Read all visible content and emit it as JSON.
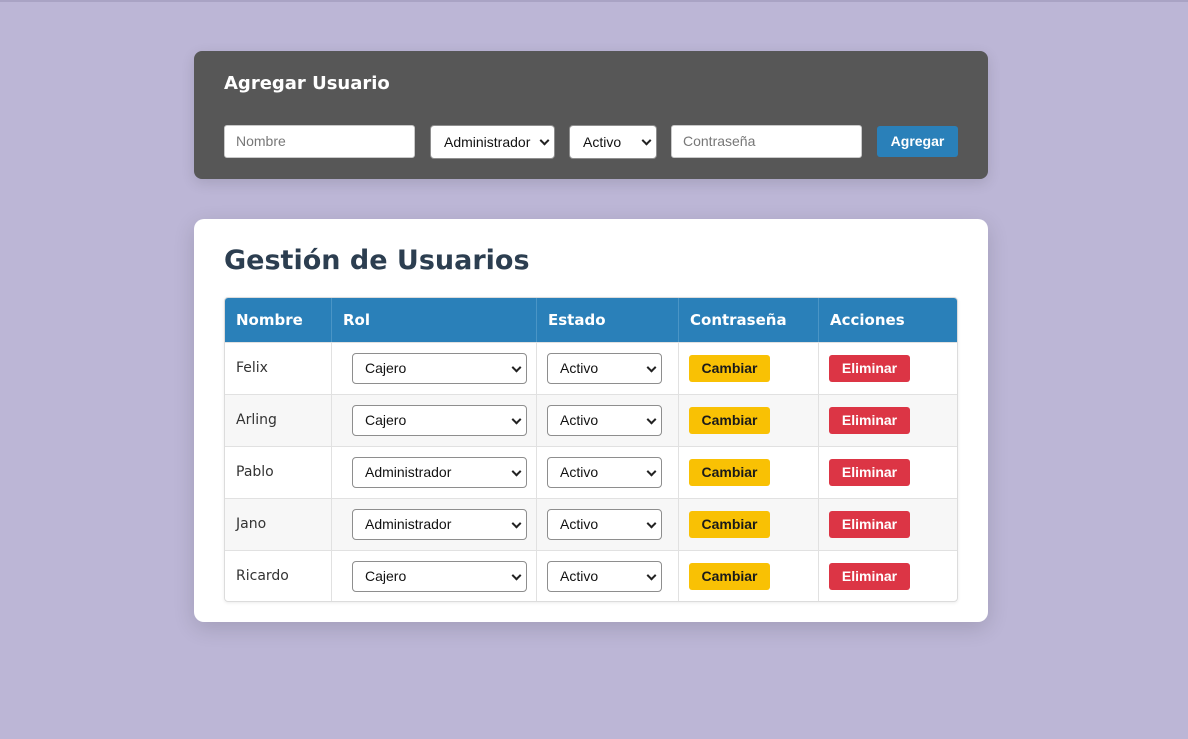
{
  "add_form": {
    "title": "Agregar Usuario",
    "name_placeholder": "Nombre",
    "role_selected": "Administrador",
    "status_selected": "Activo",
    "password_placeholder": "Contraseña",
    "submit_label": "Agregar"
  },
  "users_card": {
    "title": "Gestión de Usuarios",
    "columns": [
      "Nombre",
      "Rol",
      "Estado",
      "Contraseña",
      "Acciones"
    ],
    "change_label": "Cambiar",
    "delete_label": "Eliminar",
    "rows": [
      {
        "name": "Felix",
        "role": "Cajero",
        "status": "Activo"
      },
      {
        "name": "Arling",
        "role": "Cajero",
        "status": "Activo"
      },
      {
        "name": "Pablo",
        "role": "Administrador",
        "status": "Activo"
      },
      {
        "name": "Jano",
        "role": "Administrador",
        "status": "Activo"
      },
      {
        "name": "Ricardo",
        "role": "Cajero",
        "status": "Activo"
      }
    ]
  },
  "colors": {
    "background": "#bcb6d6",
    "panel": "#575757",
    "primary": "#2a80b9",
    "warning": "#f9c104",
    "danger": "#dc3545",
    "title": "#2c3e50"
  }
}
